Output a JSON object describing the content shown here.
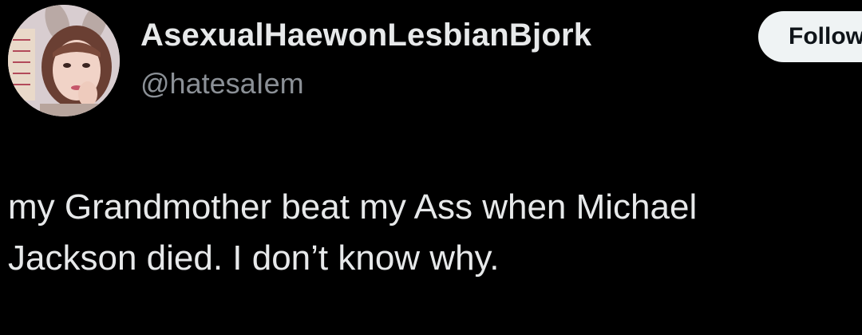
{
  "author": {
    "display_name": "AsexualHaewonLesbianBjork",
    "handle": "@hatesaIem",
    "avatar_icon": "profile-photo"
  },
  "follow_button": {
    "label": "Follow"
  },
  "tweet": {
    "lines": [
      "my Grandmother beat my Ass when Michael",
      "Jackson died. I don’t know why."
    ]
  },
  "colors": {
    "background": "#000000",
    "text": "#e7e9ea",
    "handle": "#8b9096",
    "button_bg": "#eff3f4",
    "button_text": "#0f1419"
  }
}
